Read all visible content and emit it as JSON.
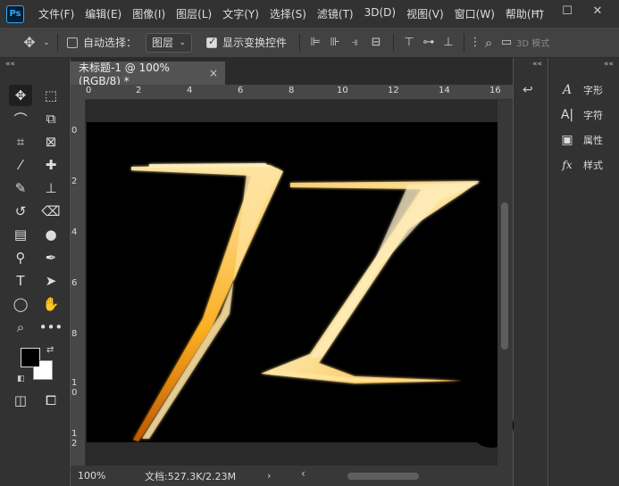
{
  "app": {
    "logo": "Ps"
  },
  "menu": [
    "文件(F)",
    "编辑(E)",
    "图像(I)",
    "图层(L)",
    "文字(Y)",
    "选择(S)",
    "滤镜(T)",
    "3D(D)",
    "视图(V)",
    "窗口(W)",
    "帮助(H)"
  ],
  "window_controls": {
    "minimize": "—",
    "maximize": "☐",
    "close": "✕"
  },
  "options": {
    "auto_select_label": "自动选择：",
    "layer_select_value": "图层",
    "show_transform_label": "显示变换控件",
    "mode_3d": "3D 模式"
  },
  "document": {
    "tab_title": "未标题-1 @ 100%(RGB/8) *",
    "tab_close": "×",
    "zoom": "100%",
    "doc_info": "文档:527.3K/2.23M",
    "ruler_top": [
      "0",
      "2",
      "4",
      "6",
      "8",
      "10",
      "12",
      "14",
      "16"
    ],
    "ruler_left": [
      "0",
      "2",
      "4",
      "6",
      "8",
      "10",
      "12"
    ],
    "artwork_colors": {
      "bright": "#ffe9a8",
      "mid": "#ffb020",
      "deep": "#c25a00"
    }
  },
  "panels": {
    "collapse": "««",
    "items": [
      {
        "label": "字形",
        "icon": "glyph-icon"
      },
      {
        "label": "字符",
        "icon": "character-icon"
      },
      {
        "label": "属性",
        "icon": "properties-icon"
      },
      {
        "label": "样式",
        "icon": "styles-icon"
      }
    ]
  },
  "colors": {
    "foreground": "#000000",
    "background": "#ffffff"
  }
}
